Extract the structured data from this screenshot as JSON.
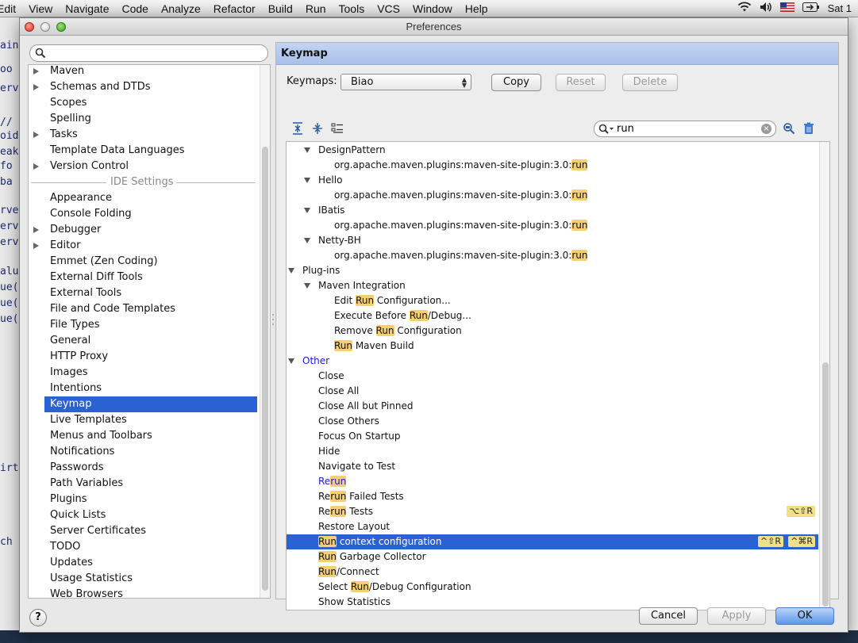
{
  "menubar": {
    "items": [
      "Edit",
      "View",
      "Navigate",
      "Code",
      "Analyze",
      "Refactor",
      "Build",
      "Run",
      "Tools",
      "VCS",
      "Window",
      "Help"
    ],
    "clock": "Sat 1"
  },
  "window": {
    "title": "Preferences"
  },
  "sidebar": {
    "search_placeholder": "",
    "items": [
      {
        "label": "Maven",
        "arrow": true
      },
      {
        "label": "Schemas and DTDs",
        "arrow": true
      },
      {
        "label": "Scopes",
        "arrow": false
      },
      {
        "label": "Spelling",
        "arrow": false
      },
      {
        "label": "Tasks",
        "arrow": true
      },
      {
        "label": "Template Data Languages",
        "arrow": false
      },
      {
        "label": "Version Control",
        "arrow": true
      }
    ],
    "section": "IDE Settings",
    "ide_items": [
      {
        "label": "Appearance",
        "arrow": false
      },
      {
        "label": "Console Folding",
        "arrow": false
      },
      {
        "label": "Debugger",
        "arrow": true
      },
      {
        "label": "Editor",
        "arrow": true
      },
      {
        "label": "Emmet (Zen Coding)",
        "arrow": false
      },
      {
        "label": "External Diff Tools",
        "arrow": false
      },
      {
        "label": "External Tools",
        "arrow": false
      },
      {
        "label": "File and Code Templates",
        "arrow": false
      },
      {
        "label": "File Types",
        "arrow": false
      },
      {
        "label": "General",
        "arrow": false
      },
      {
        "label": "HTTP Proxy",
        "arrow": false
      },
      {
        "label": "Images",
        "arrow": false
      },
      {
        "label": "Intentions",
        "arrow": false
      },
      {
        "label": "Keymap",
        "arrow": false,
        "selected": true
      },
      {
        "label": "Live Templates",
        "arrow": false
      },
      {
        "label": "Menus and Toolbars",
        "arrow": false
      },
      {
        "label": "Notifications",
        "arrow": false
      },
      {
        "label": "Passwords",
        "arrow": false
      },
      {
        "label": "Path Variables",
        "arrow": false
      },
      {
        "label": "Plugins",
        "arrow": false
      },
      {
        "label": "Quick Lists",
        "arrow": false
      },
      {
        "label": "Server Certificates",
        "arrow": false
      },
      {
        "label": "TODO",
        "arrow": false
      },
      {
        "label": "Updates",
        "arrow": false
      },
      {
        "label": "Usage Statistics",
        "arrow": false
      },
      {
        "label": "Web Browsers",
        "arrow": false
      }
    ]
  },
  "keymap": {
    "header": "Keymap",
    "keymaps_label": "Keymaps:",
    "selected_keymap": "Biao",
    "copy_label": "Copy",
    "reset_label": "Reset",
    "delete_label": "Delete",
    "filter_value": "run",
    "tree": [
      {
        "indent": 1,
        "tri": true,
        "parts": [
          [
            "DesignPattern",
            false
          ]
        ]
      },
      {
        "indent": 2,
        "tri": false,
        "parts": [
          [
            "org.apache.maven.plugins:maven-site-plugin:3.0:",
            false
          ],
          [
            "run",
            true
          ]
        ]
      },
      {
        "indent": 1,
        "tri": true,
        "parts": [
          [
            "Hello",
            false
          ]
        ]
      },
      {
        "indent": 2,
        "tri": false,
        "parts": [
          [
            "org.apache.maven.plugins:maven-site-plugin:3.0:",
            false
          ],
          [
            "run",
            true
          ]
        ]
      },
      {
        "indent": 1,
        "tri": true,
        "parts": [
          [
            "IBatis",
            false
          ]
        ]
      },
      {
        "indent": 2,
        "tri": false,
        "parts": [
          [
            "org.apache.maven.plugins:maven-site-plugin:3.0:",
            false
          ],
          [
            "run",
            true
          ]
        ]
      },
      {
        "indent": 1,
        "tri": true,
        "parts": [
          [
            "Netty-BH",
            false
          ]
        ]
      },
      {
        "indent": 2,
        "tri": false,
        "parts": [
          [
            "org.apache.maven.plugins:maven-site-plugin:3.0:",
            false
          ],
          [
            "run",
            true
          ]
        ]
      },
      {
        "indent": 0,
        "tri": true,
        "parts": [
          [
            "Plug-ins",
            false
          ]
        ]
      },
      {
        "indent": 1,
        "tri": true,
        "parts": [
          [
            "Maven Integration",
            false
          ]
        ]
      },
      {
        "indent": 2,
        "tri": false,
        "parts": [
          [
            "Edit ",
            false
          ],
          [
            "Run",
            true
          ],
          [
            " Configuration...",
            false
          ]
        ]
      },
      {
        "indent": 2,
        "tri": false,
        "parts": [
          [
            "Execute Before ",
            false
          ],
          [
            "Run",
            true
          ],
          [
            "/Debug...",
            false
          ]
        ]
      },
      {
        "indent": 2,
        "tri": false,
        "parts": [
          [
            "Remove ",
            false
          ],
          [
            "Run",
            true
          ],
          [
            " Configuration",
            false
          ]
        ]
      },
      {
        "indent": 2,
        "tri": false,
        "parts": [
          [
            "Run",
            true
          ],
          [
            " Maven Build",
            false
          ]
        ]
      },
      {
        "indent": 0,
        "tri": true,
        "blue": true,
        "parts": [
          [
            "Other",
            false
          ]
        ]
      },
      {
        "indent": 1,
        "tri": false,
        "parts": [
          [
            "Close",
            false
          ]
        ]
      },
      {
        "indent": 1,
        "tri": false,
        "parts": [
          [
            "Close All",
            false
          ]
        ]
      },
      {
        "indent": 1,
        "tri": false,
        "parts": [
          [
            "Close All but Pinned",
            false
          ]
        ]
      },
      {
        "indent": 1,
        "tri": false,
        "parts": [
          [
            "Close Others",
            false
          ]
        ]
      },
      {
        "indent": 1,
        "tri": false,
        "parts": [
          [
            "Focus On Startup",
            false
          ]
        ]
      },
      {
        "indent": 1,
        "tri": false,
        "parts": [
          [
            "Hide",
            false
          ]
        ]
      },
      {
        "indent": 1,
        "tri": false,
        "parts": [
          [
            "Navigate to Test",
            false
          ]
        ]
      },
      {
        "indent": 1,
        "tri": false,
        "blue": true,
        "parts": [
          [
            "Re",
            false
          ],
          [
            "run",
            true
          ]
        ]
      },
      {
        "indent": 1,
        "tri": false,
        "parts": [
          [
            "Re",
            false
          ],
          [
            "run",
            true
          ],
          [
            " Failed Tests",
            false
          ]
        ]
      },
      {
        "indent": 1,
        "tri": false,
        "parts": [
          [
            "Re",
            false
          ],
          [
            "run",
            true
          ],
          [
            " Tests",
            false
          ]
        ],
        "shortcuts": [
          "⌥⇧R"
        ]
      },
      {
        "indent": 1,
        "tri": false,
        "parts": [
          [
            "Restore Layout",
            false
          ]
        ]
      },
      {
        "indent": 1,
        "tri": false,
        "selected": true,
        "parts": [
          [
            "Run",
            true
          ],
          [
            " context configuration",
            false
          ]
        ],
        "shortcuts": [
          "^⇧R",
          "^⌘R"
        ]
      },
      {
        "indent": 1,
        "tri": false,
        "parts": [
          [
            "Run",
            true
          ],
          [
            " Garbage Collector",
            false
          ]
        ]
      },
      {
        "indent": 1,
        "tri": false,
        "parts": [
          [
            "Run",
            true
          ],
          [
            "/Connect",
            false
          ]
        ]
      },
      {
        "indent": 1,
        "tri": false,
        "parts": [
          [
            "Select ",
            false
          ],
          [
            "Run",
            true
          ],
          [
            "/Debug Configuration",
            false
          ]
        ]
      },
      {
        "indent": 1,
        "tri": false,
        "parts": [
          [
            "Show Statistics",
            false
          ]
        ]
      }
    ]
  },
  "footer": {
    "help_label": "?",
    "cancel_label": "Cancel",
    "apply_label": "Apply",
    "ok_label": "OK"
  },
  "colors": {
    "selection": "#2a62d4",
    "highlight": "#f5cf73",
    "header": "#b3c8ef"
  }
}
